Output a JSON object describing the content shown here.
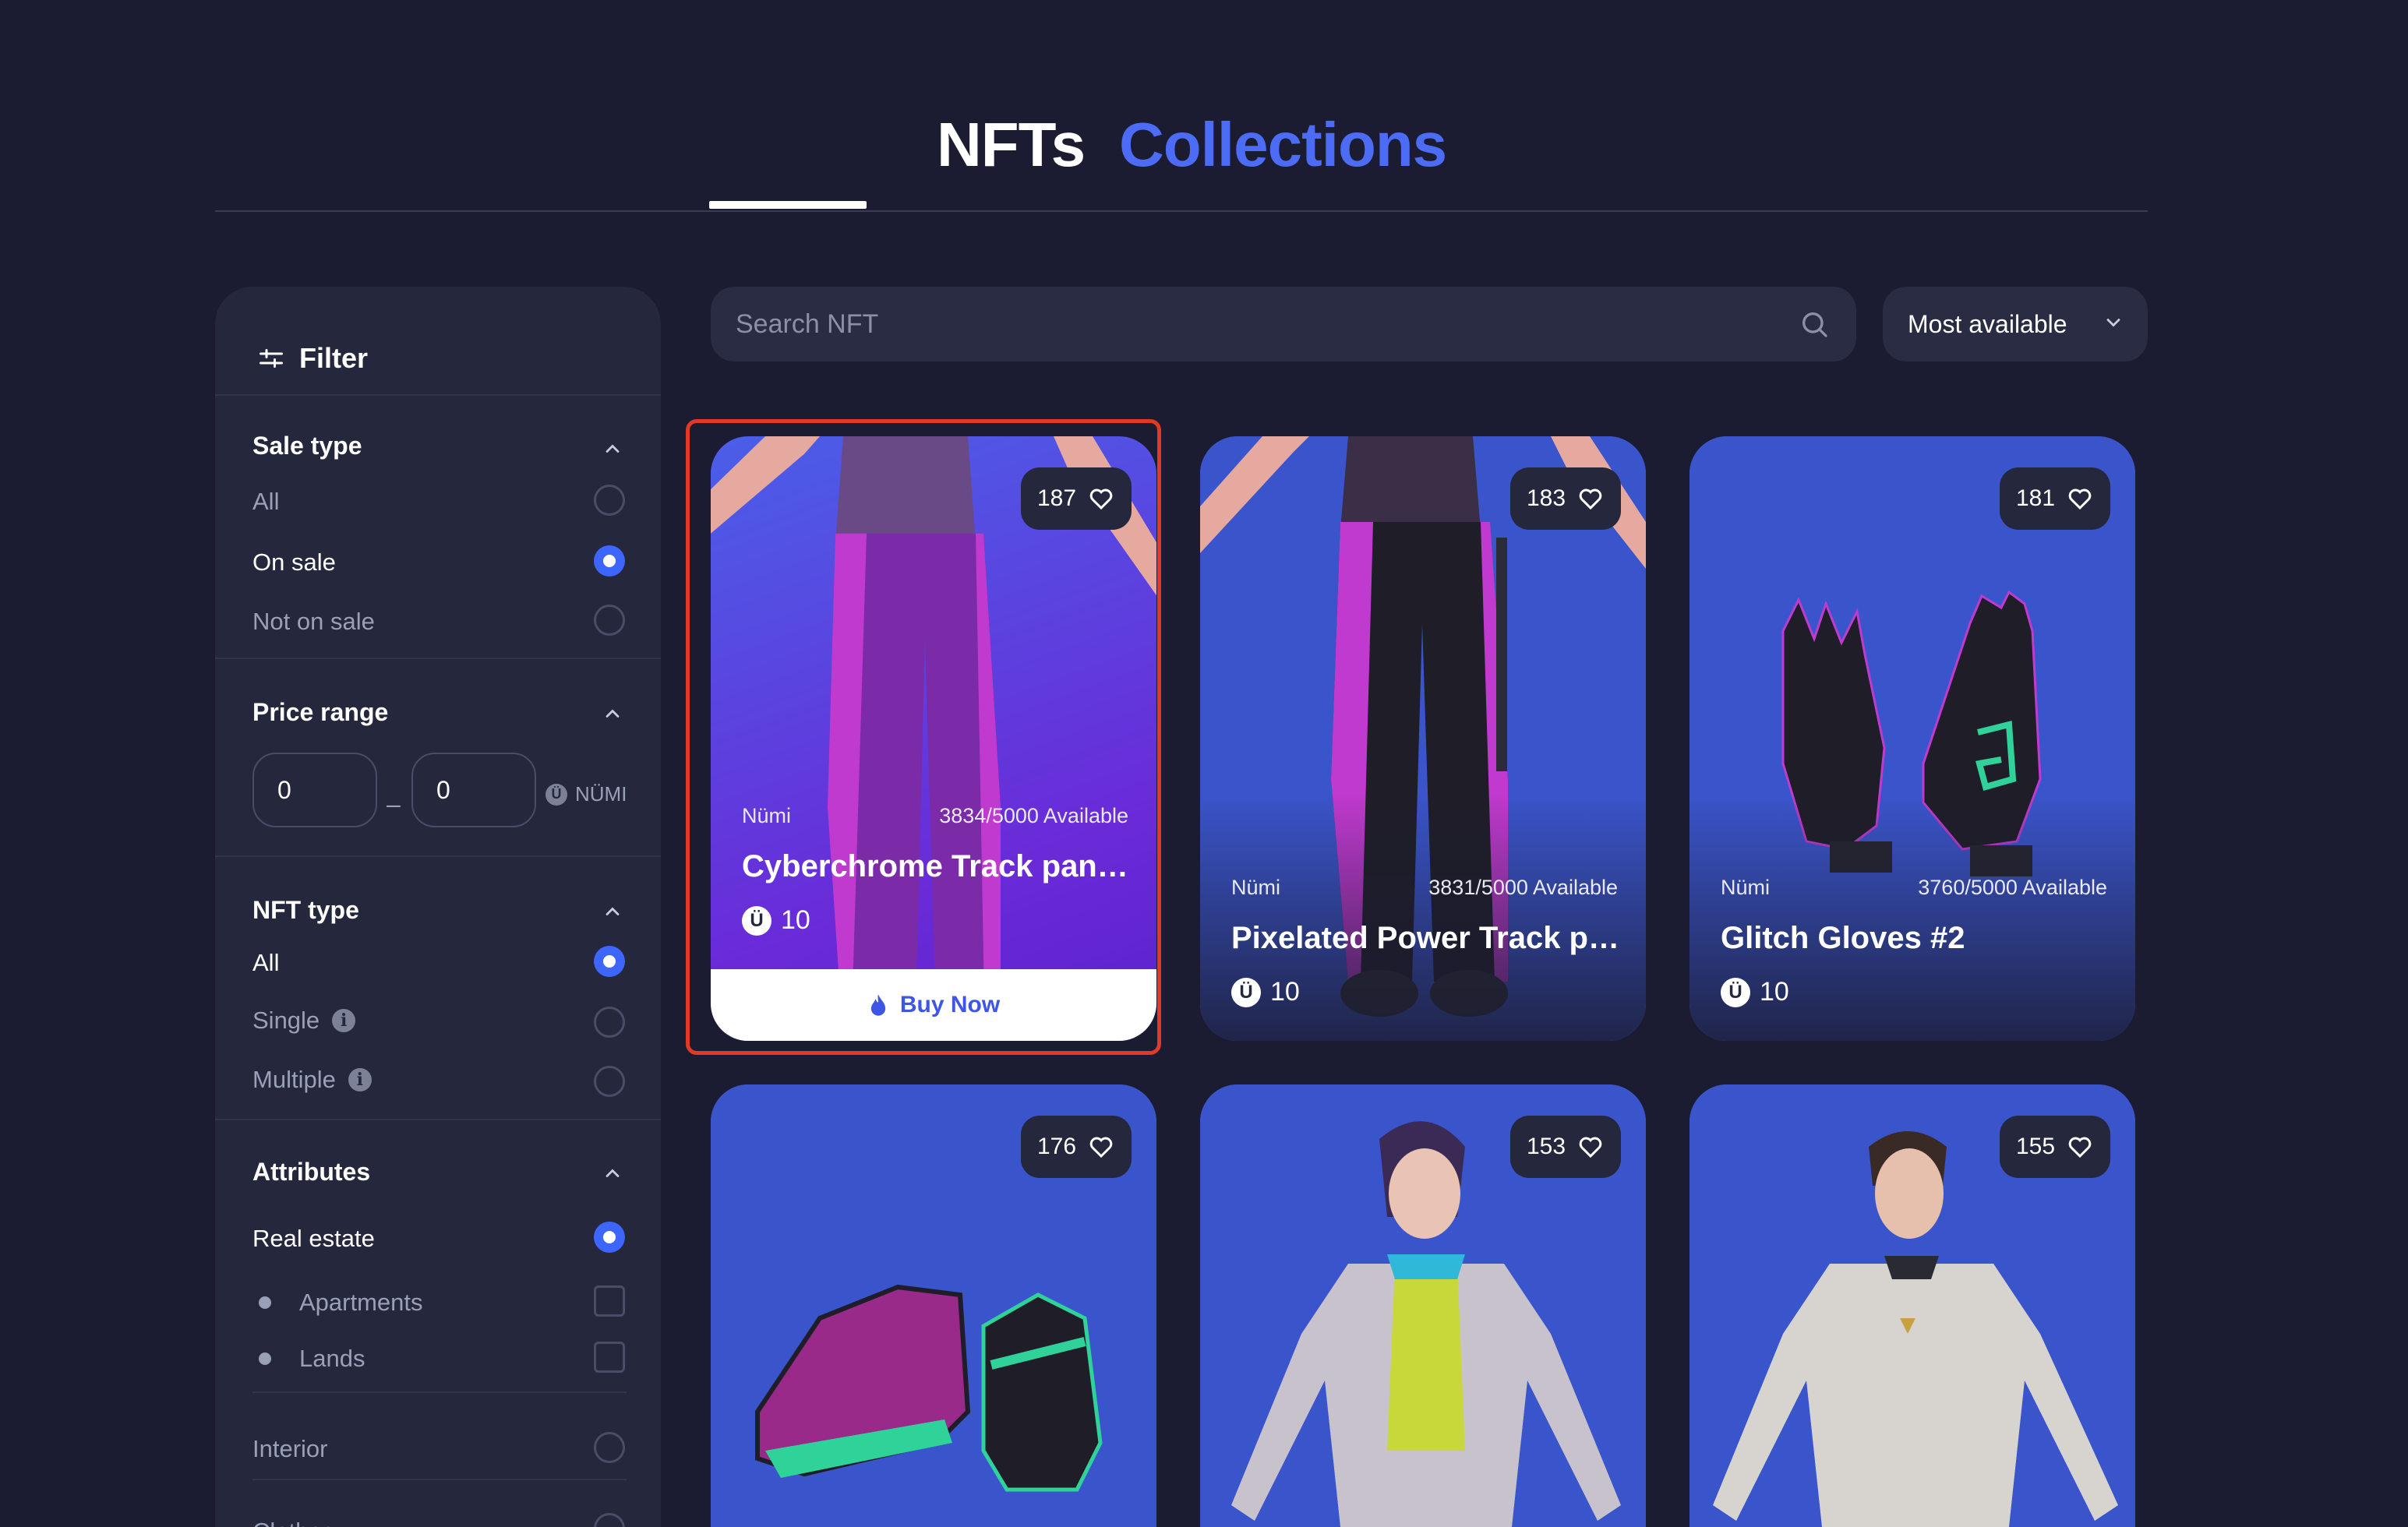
{
  "tabs": [
    {
      "label": "NFTs",
      "active": true
    },
    {
      "label": "Collections",
      "active": false
    }
  ],
  "sidebar": {
    "filter_label": "Filter",
    "sale_type": {
      "title": "Sale type",
      "options": [
        {
          "label": "All",
          "selected": false
        },
        {
          "label": "On sale",
          "selected": true
        },
        {
          "label": "Not on sale",
          "selected": false
        }
      ]
    },
    "price_range": {
      "title": "Price range",
      "min": "0",
      "max": "0",
      "dash": "–",
      "currency": "NÜMI"
    },
    "nft_type": {
      "title": "NFT type",
      "options": [
        {
          "label": "All",
          "selected": true
        },
        {
          "label": "Single",
          "selected": false
        },
        {
          "label": "Multiple",
          "selected": false
        }
      ]
    },
    "attributes": {
      "title": "Attributes",
      "options": [
        {
          "label": "Real estate",
          "selected": true
        },
        {
          "label": "Apartments",
          "selected": false
        },
        {
          "label": "Lands",
          "selected": false
        },
        {
          "label": "Interior",
          "selected": false
        },
        {
          "label": "Clothes",
          "selected": false
        }
      ]
    }
  },
  "search": {
    "placeholder": "Search NFT"
  },
  "sort": {
    "selected": "Most available"
  },
  "cards": [
    {
      "likes": "187",
      "creator": "Nümi",
      "availability": "3834/5000 Available",
      "title": "Cyberchrome Track pants...",
      "price": "10",
      "button": "Buy Now"
    },
    {
      "likes": "183",
      "creator": "Nümi",
      "availability": "3831/5000 Available",
      "title": "Pixelated Power Track pa...",
      "price": "10"
    },
    {
      "likes": "181",
      "creator": "Nümi",
      "availability": "3760/5000 Available",
      "title": "Glitch Gloves #2",
      "price": "10"
    },
    {
      "likes": "176"
    },
    {
      "likes": "153"
    },
    {
      "likes": "155"
    }
  ],
  "colors": {
    "background": "#1b1c31",
    "panel": "#25273d",
    "accent": "#3d66ff",
    "tab_inactive": "#4c6cf5",
    "card_bg": "#3650c7",
    "highlight": "#e03a24"
  },
  "icons": {
    "filter": "sliders-icon",
    "collapse": "chevron-up-icon",
    "search": "search-icon",
    "sort": "chevron-down-icon",
    "like": "heart-icon",
    "buy": "flame-icon",
    "info": "info-icon",
    "coin": "numi-coin-icon"
  }
}
